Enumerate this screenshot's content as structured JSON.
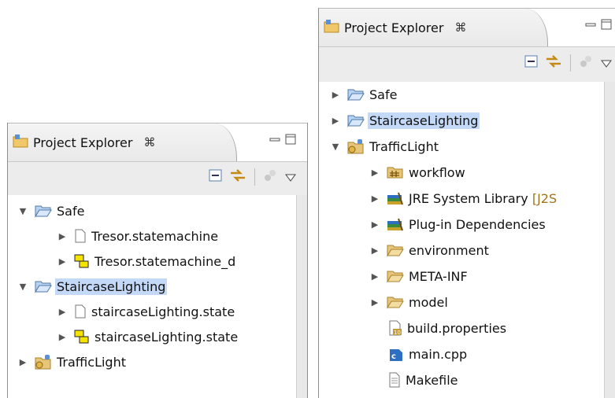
{
  "colors": {
    "selection": "#c3d9f7",
    "toolbar_bg": "#ececec",
    "folder_blue": "#9bc2ea",
    "folder_tan": "#e7c57a",
    "library_green": "#3c8a3c"
  },
  "left_panel": {
    "tab": {
      "title": "Project Explorer",
      "close_glyph": "⌘"
    },
    "tree": [
      {
        "label": "Safe",
        "expanded": true,
        "icon": "folder-open-blue-icon"
      },
      {
        "label": "Tresor.statemachine",
        "icon": "file-icon"
      },
      {
        "label": "Tresor.statemachine_d",
        "icon": "diagram-icon"
      },
      {
        "label": "StaircaseLighting",
        "expanded": true,
        "selected": true,
        "icon": "folder-open-blue-icon"
      },
      {
        "label": "staircaseLighting.state",
        "icon": "file-icon"
      },
      {
        "label": "staircaseLighting.state",
        "icon": "diagram-icon"
      },
      {
        "label": "TrafficLight",
        "expanded": false,
        "icon": "project-icon"
      }
    ]
  },
  "right_panel": {
    "tab": {
      "title": "Project Explorer",
      "close_glyph": "⌘"
    },
    "tree": [
      {
        "label": "Safe",
        "icon": "folder-blue-icon"
      },
      {
        "label": "StaircaseLighting",
        "selected": true,
        "icon": "folder-blue-icon"
      },
      {
        "label": "TrafficLight",
        "expanded": true,
        "icon": "project-icon"
      },
      {
        "label": "workflow",
        "icon": "package-folder-icon"
      },
      {
        "label": "JRE System Library",
        "suffix": "[J2S",
        "icon": "library-icon"
      },
      {
        "label": "Plug-in Dependencies",
        "icon": "library-icon"
      },
      {
        "label": "environment",
        "icon": "folder-tan-icon"
      },
      {
        "label": "META-INF",
        "icon": "folder-tan-icon"
      },
      {
        "label": "model",
        "icon": "folder-tan-icon"
      },
      {
        "label": "build.properties",
        "icon": "properties-file-icon"
      },
      {
        "label": "main.cpp",
        "icon": "cpp-file-icon"
      },
      {
        "label": "Makefile",
        "icon": "text-file-icon"
      }
    ]
  }
}
